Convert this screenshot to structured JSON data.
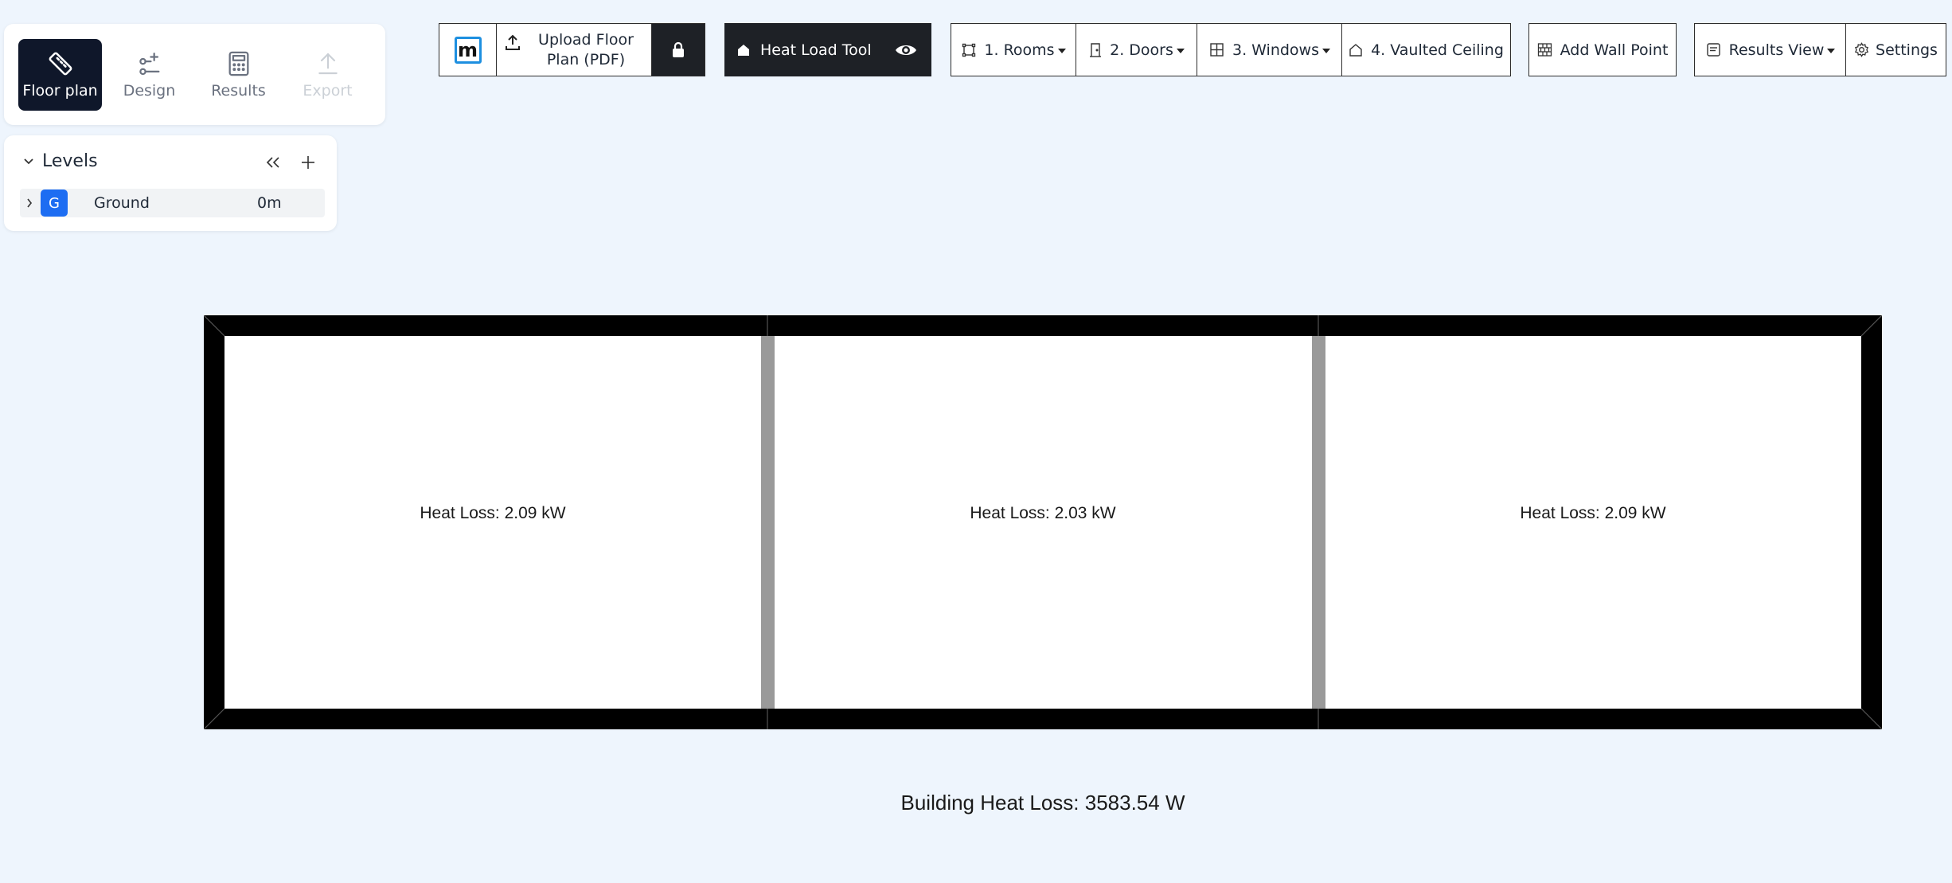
{
  "modes": {
    "floor_plan": "Floor plan",
    "design": "Design",
    "results": "Results",
    "export": "Export"
  },
  "levels": {
    "title": "Levels",
    "items": [
      {
        "badge": "G",
        "name": "Ground",
        "height": "0m"
      }
    ]
  },
  "toolbar": {
    "logo": "m",
    "upload_label": "Upload Floor Plan (PDF)",
    "heat_load_tool": "Heat Load Tool",
    "rooms": "1. Rooms",
    "doors": "2. Doors",
    "windows": "3. Windows",
    "vaulted_ceiling": "4. Vaulted Ceiling",
    "add_wall_point": "Add Wall Point",
    "results_view": "Results View",
    "settings": "Settings"
  },
  "rooms": [
    {
      "heat_loss": "Heat Loss: 2.09 kW"
    },
    {
      "heat_loss": "Heat Loss: 2.03 kW"
    },
    {
      "heat_loss": "Heat Loss: 2.09 kW"
    }
  ],
  "building_heat_loss": "Building Heat Loss: 3583.54 W",
  "colors": {
    "background": "#eef5fd",
    "accent_blue": "#1d6df2",
    "dark": "#1e2126",
    "wall": "#000000",
    "internal_wall": "#9a9a9a"
  }
}
